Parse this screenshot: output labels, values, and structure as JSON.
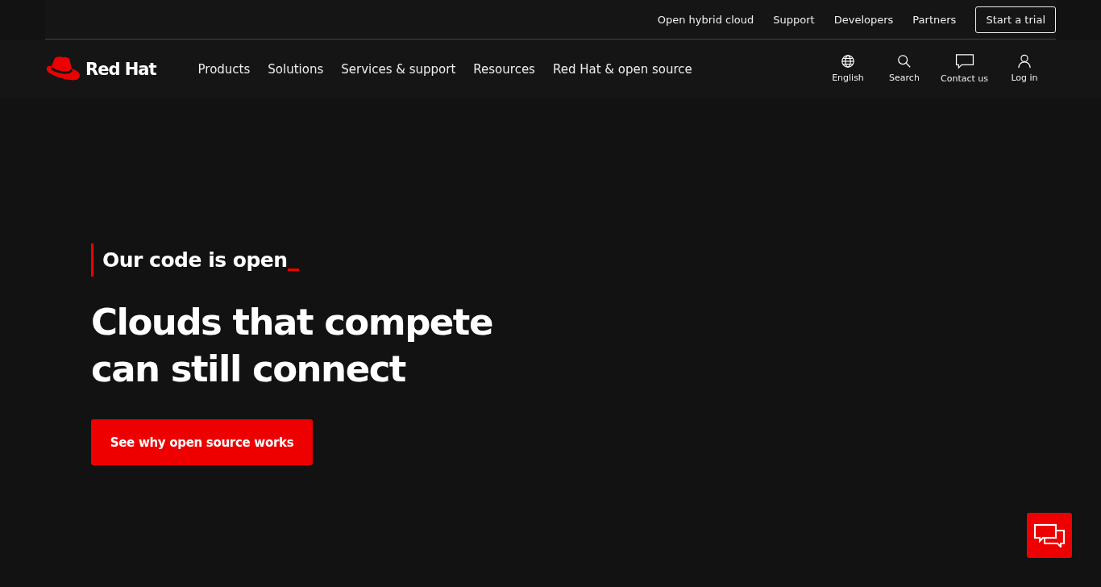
{
  "utility_nav": [
    {
      "label": "Open hybrid cloud",
      "kind": "link"
    },
    {
      "label": "Support",
      "kind": "link"
    },
    {
      "label": "Developers",
      "kind": "link"
    },
    {
      "label": "Partners",
      "kind": "link"
    },
    {
      "label": "Start a trial",
      "kind": "button"
    }
  ],
  "logo": {
    "text": "Red Hat"
  },
  "main_nav": [
    "Products",
    "Solutions",
    "Services & support",
    "Resources",
    "Red Hat & open source"
  ],
  "tools": [
    {
      "label": "English",
      "kind": "globe"
    },
    {
      "label": "Search",
      "kind": "search"
    },
    {
      "label": "Contact us",
      "kind": "chat"
    },
    {
      "label": "Log in",
      "kind": "user"
    }
  ],
  "hero": {
    "eyebrow": "Our code is open",
    "title_lines": [
      "Clouds that compete",
      "can still connect"
    ],
    "cta": "See why open source works"
  },
  "chat_button": {
    "kind": "chat"
  }
}
